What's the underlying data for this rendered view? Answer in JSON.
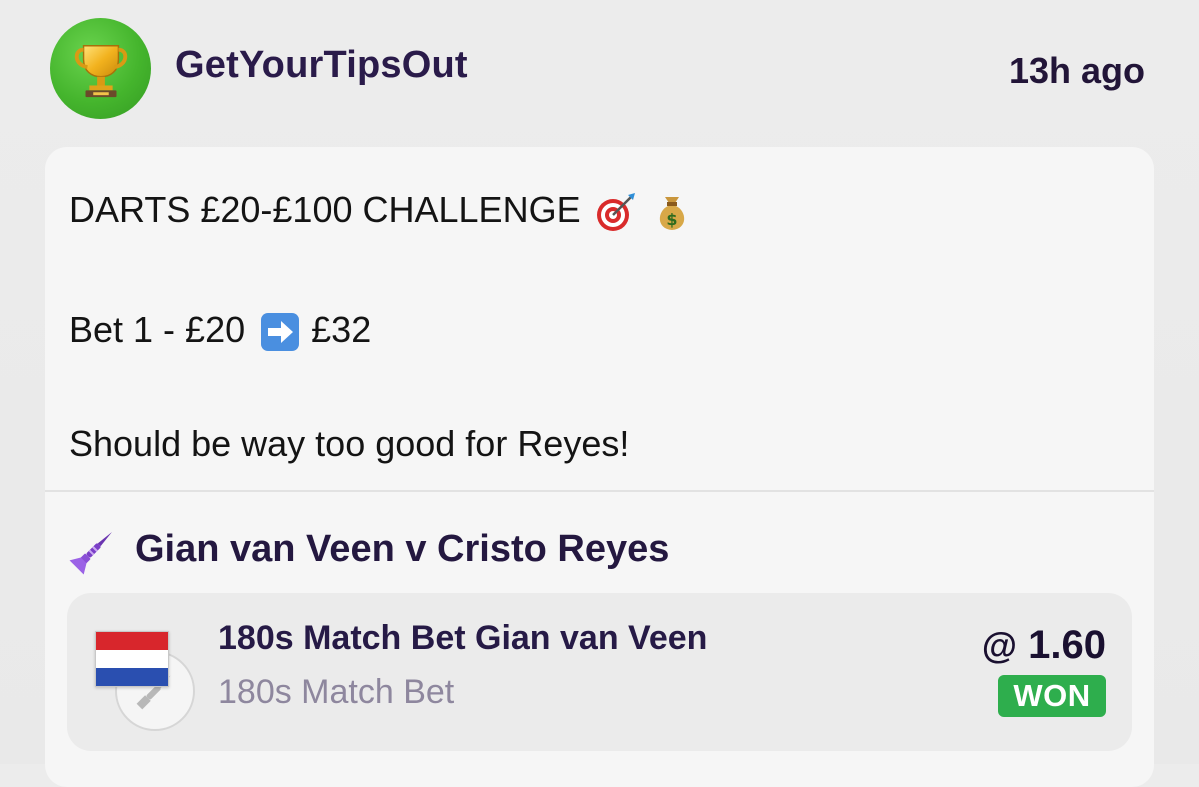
{
  "post": {
    "username": "GetYourTipsOut",
    "time": "13h ago",
    "avatar_icon": "trophy-icon",
    "line1_text": "DARTS £20-£100 CHALLENGE",
    "line1_emojis": [
      "dart-target-emoji",
      "money-bag-emoji"
    ],
    "line2_before": "Bet 1 - £20",
    "line2_arrow": "right-arrow-emoji",
    "line2_after": "£32",
    "line3_text": "Should be way too good for Reyes!"
  },
  "match": {
    "icon": "dart-icon",
    "title": "Gian van Veen v Cristo Reyes"
  },
  "bet": {
    "flag": "netherlands-flag",
    "title": "180s Match Bet Gian van Veen",
    "subtitle": "180s Match Bet",
    "odds_prefix": "@",
    "odds": "1.60",
    "status": "WON"
  },
  "colors": {
    "accent_purple": "#8a4fd6",
    "won_green": "#2eae4d",
    "avatar_green": "#45b52d"
  }
}
